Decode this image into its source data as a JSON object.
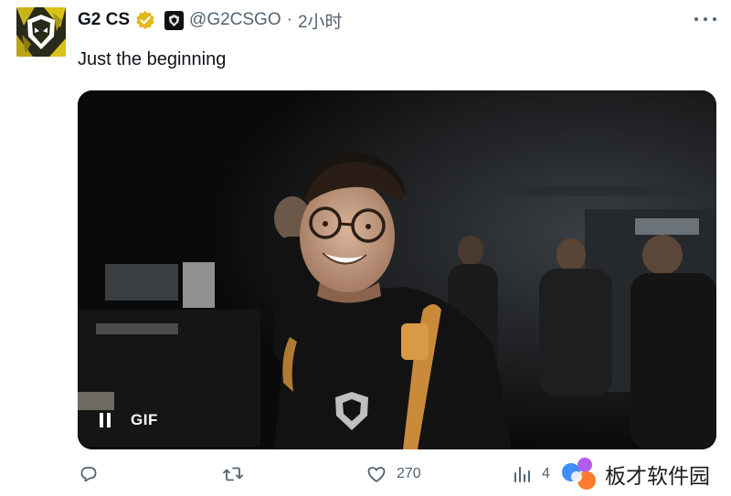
{
  "tweet": {
    "display_name": "G2 CS",
    "handle": "@G2CSGO",
    "separator": "·",
    "time": "2小时",
    "text": "Just the beginning"
  },
  "media": {
    "gif_label": "GIF",
    "pause_icon": "pause-icon"
  },
  "actions": {
    "reply_count": "",
    "retweet_count": "",
    "like_count": "270",
    "views_count": "4"
  },
  "watermark": {
    "text": "板才软件园"
  },
  "colors": {
    "text_primary": "#0f1419",
    "text_secondary": "#536471",
    "verified_gold": "#e2b719",
    "avatar_yellow": "#d9c21a"
  }
}
